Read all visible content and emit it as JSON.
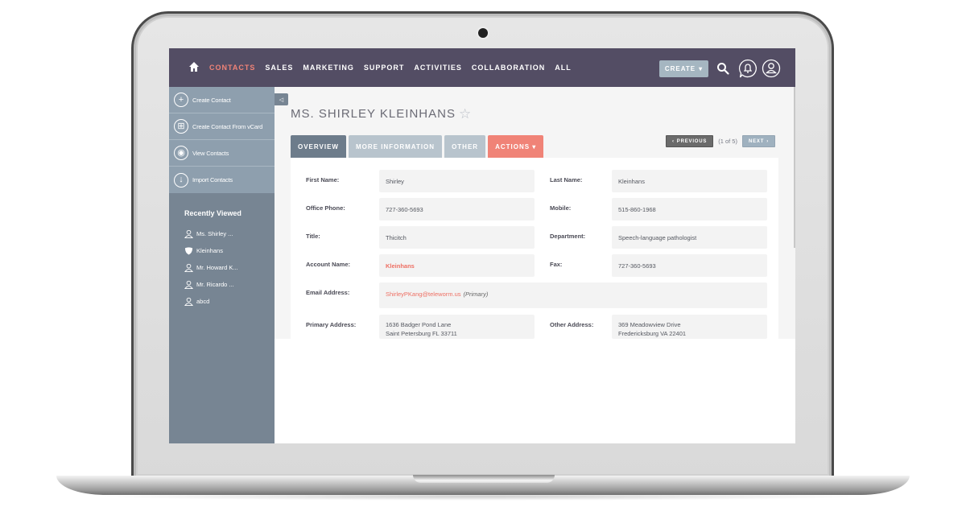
{
  "nav": {
    "home_icon": "home-icon",
    "items": [
      {
        "label": "CONTACTS",
        "active": true
      },
      {
        "label": "SALES",
        "active": false
      },
      {
        "label": "MARKETING",
        "active": false
      },
      {
        "label": "SUPPORT",
        "active": false
      },
      {
        "label": "ACTIVITIES",
        "active": false
      },
      {
        "label": "COLLABORATION",
        "active": false
      },
      {
        "label": "ALL",
        "active": false
      }
    ],
    "create_label": "CREATE",
    "create_caret": "▾",
    "active_color": "#f08377",
    "bar_color": "#534d64"
  },
  "sidebar": {
    "actions": [
      {
        "label": "Create Contact",
        "icon": "plus-icon",
        "glyph": "+"
      },
      {
        "label": "Create Contact From vCard",
        "icon": "vcard-icon",
        "glyph": "⊞"
      },
      {
        "label": "View Contacts",
        "icon": "eye-icon",
        "glyph": "◉"
      },
      {
        "label": "Import Contacts",
        "icon": "download-icon",
        "glyph": "↓"
      }
    ],
    "recent_title": "Recently Viewed",
    "recent": [
      {
        "label": "Ms. Shirley ...",
        "icon": "person-icon"
      },
      {
        "label": "Kleinhans",
        "icon": "shield-icon"
      },
      {
        "label": "Mr. Howard K...",
        "icon": "person-icon"
      },
      {
        "label": "Mr. Ricardo ...",
        "icon": "person-icon"
      },
      {
        "label": "abcd",
        "icon": "person-icon"
      }
    ],
    "collapse_glyph": "◁"
  },
  "record": {
    "title": "MS. SHIRLEY KLEINHANS",
    "star_glyph": "☆",
    "tabs": [
      {
        "label": "OVERVIEW",
        "key": "overview"
      },
      {
        "label": "MORE INFORMATION",
        "key": "more"
      },
      {
        "label": "OTHER",
        "key": "other"
      },
      {
        "label": "ACTIONS ▾",
        "key": "actions"
      }
    ],
    "pager": {
      "previous_label": "PREVIOUS",
      "previous_glyph": "‹",
      "count": "(1 of 5)",
      "next_label": "NEXT",
      "next_glyph": "›"
    },
    "fields": {
      "first_name": {
        "label": "First Name:",
        "value": "Shirley"
      },
      "last_name": {
        "label": "Last Name:",
        "value": "Kleinhans"
      },
      "office_phone": {
        "label": "Office Phone:",
        "value": "727-360-5693"
      },
      "mobile": {
        "label": "Mobile:",
        "value": "515-860-1968"
      },
      "title": {
        "label": "Title:",
        "value": "Thicitch"
      },
      "department": {
        "label": "Department:",
        "value": "Speech-language pathologist"
      },
      "account_name": {
        "label": "Account Name:",
        "value": "Kleinhans"
      },
      "fax": {
        "label": "Fax:",
        "value": "727-360-5693"
      },
      "email": {
        "label": "Email Address:",
        "value": "ShirleyPKang@teleworm.us",
        "note": "(Primary)"
      },
      "primary_address": {
        "label": "Primary Address:",
        "line1": "1636 Badger Pond Lane",
        "line2": "Saint Petersburg FL  33711"
      },
      "other_address": {
        "label": "Other Address:",
        "line1": "369 Meadowview Drive",
        "line2": "Fredericksburg VA  22401"
      }
    }
  }
}
